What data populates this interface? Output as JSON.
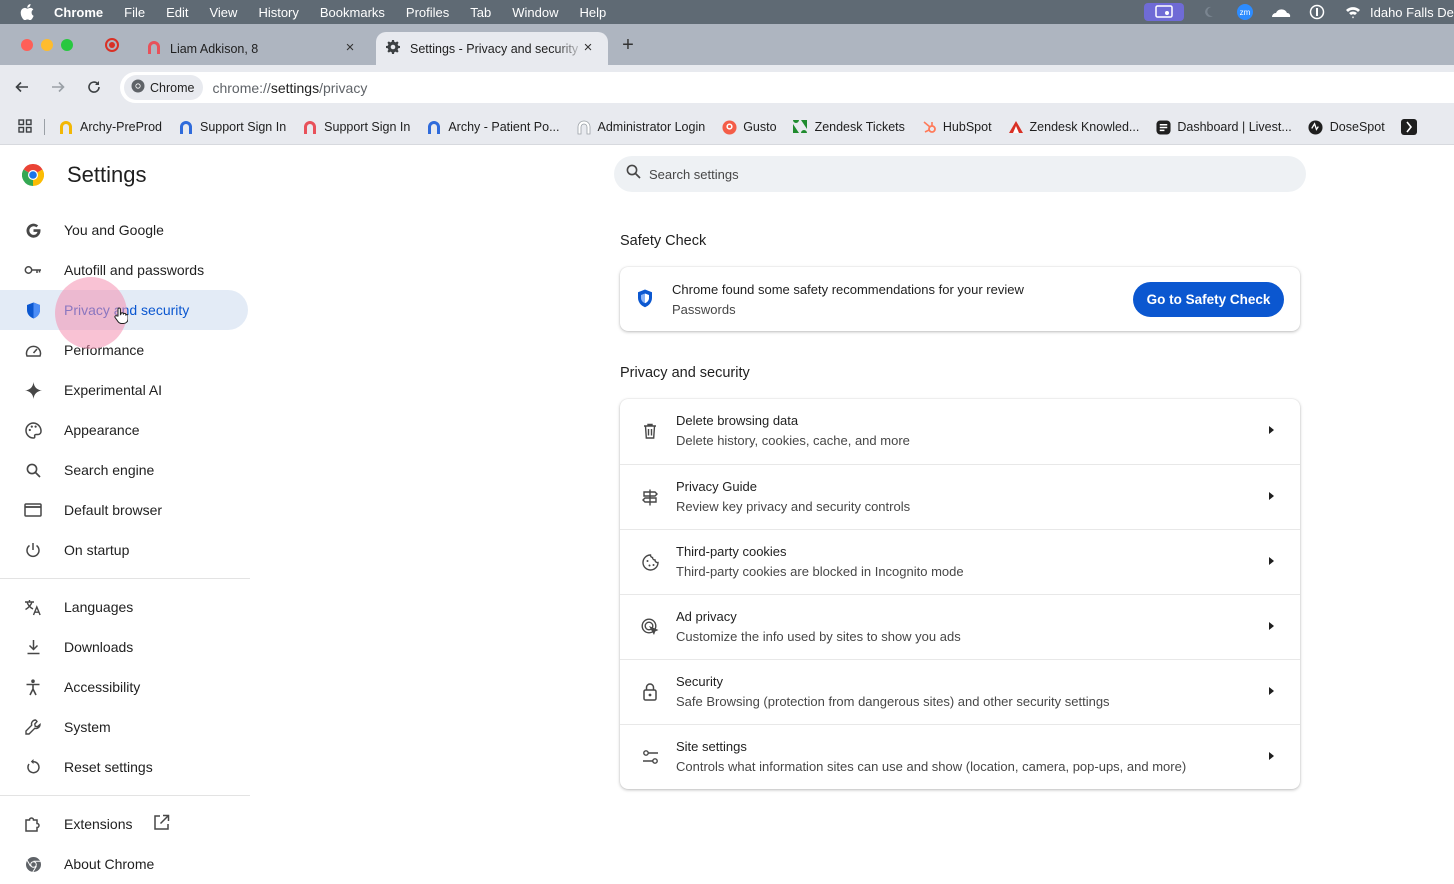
{
  "menubar": {
    "items": [
      "Chrome",
      "File",
      "Edit",
      "View",
      "History",
      "Bookmarks",
      "Profiles",
      "Tab",
      "Window",
      "Help"
    ],
    "right_text": "Idaho Falls De",
    "zoom_label": "zm"
  },
  "tabs": [
    {
      "title": "Liam Adkison, 8",
      "close": "×",
      "icon": "archy-logo-icon"
    },
    {
      "title": "Settings - Privacy and security",
      "close": "×",
      "icon": "gear-icon"
    }
  ],
  "new_tab_label": "+",
  "toolbar": {
    "chip_label": "Chrome",
    "url_prefix": "chrome://",
    "url_strong": "settings",
    "url_suffix": "/privacy"
  },
  "bookmarks": [
    {
      "label": "Archy-PreProd",
      "icon": "archy-logo-icon"
    },
    {
      "label": "Support Sign In",
      "icon": "archy-logo-icon"
    },
    {
      "label": "Support Sign In",
      "icon": "archy-logo-icon"
    },
    {
      "label": "Archy - Patient Po...",
      "icon": "archy-logo-icon"
    },
    {
      "label": "Administrator Login",
      "icon": "archy-logo-icon"
    },
    {
      "label": "Gusto",
      "icon": "gusto-icon"
    },
    {
      "label": "Zendesk Tickets",
      "icon": "zendesk-icon"
    },
    {
      "label": "HubSpot",
      "icon": "hubspot-icon"
    },
    {
      "label": "Zendesk Knowled...",
      "icon": "zendesk-guide-icon"
    },
    {
      "label": "Dashboard | Livest...",
      "icon": "dashboard-icon"
    },
    {
      "label": "DoseSpot",
      "icon": "dosespot-icon"
    }
  ],
  "settings": {
    "title": "Settings",
    "search_placeholder": "Search settings",
    "nav_group1": [
      {
        "label": "You and Google",
        "icon": "google-g-icon"
      },
      {
        "label": "Autofill and passwords",
        "icon": "key-icon"
      },
      {
        "label": "Privacy and security",
        "icon": "shield-icon",
        "active": true
      },
      {
        "label": "Performance",
        "icon": "speedometer-icon"
      },
      {
        "label": "Experimental AI",
        "icon": "sparkle-icon"
      },
      {
        "label": "Appearance",
        "icon": "palette-icon"
      },
      {
        "label": "Search engine",
        "icon": "search-icon"
      },
      {
        "label": "Default browser",
        "icon": "browser-window-icon"
      },
      {
        "label": "On startup",
        "icon": "power-icon"
      }
    ],
    "nav_group2": [
      {
        "label": "Languages",
        "icon": "translate-icon"
      },
      {
        "label": "Downloads",
        "icon": "download-icon"
      },
      {
        "label": "Accessibility",
        "icon": "accessibility-icon"
      },
      {
        "label": "System",
        "icon": "wrench-icon"
      },
      {
        "label": "Reset settings",
        "icon": "reset-icon"
      }
    ],
    "nav_group3": [
      {
        "label": "Extensions",
        "icon": "puzzle-icon"
      },
      {
        "label": "About Chrome",
        "icon": "chrome-logo-icon"
      }
    ],
    "safety_check": {
      "heading": "Safety Check",
      "title": "Chrome found some safety recommendations for your review",
      "subtitle": "Passwords",
      "button": "Go to Safety Check"
    },
    "privacy": {
      "heading": "Privacy and security",
      "rows": [
        {
          "title": "Delete browsing data",
          "subtitle": "Delete history, cookies, cache, and more",
          "icon": "trash-icon"
        },
        {
          "title": "Privacy Guide",
          "subtitle": "Review key privacy and security controls",
          "icon": "signpost-icon"
        },
        {
          "title": "Third-party cookies",
          "subtitle": "Third-party cookies are blocked in Incognito mode",
          "icon": "cookie-icon"
        },
        {
          "title": "Ad privacy",
          "subtitle": "Customize the info used by sites to show you ads",
          "icon": "ad-privacy-icon"
        },
        {
          "title": "Security",
          "subtitle": "Safe Browsing (protection from dangerous sites) and other security settings",
          "icon": "lock-icon"
        },
        {
          "title": "Site settings",
          "subtitle": "Controls what information sites can use and show (location, camera, pop-ups, and more)",
          "icon": "sliders-icon"
        }
      ]
    }
  },
  "colors": {
    "accent": "#0b57d0",
    "active_nav_bg": "#e3ebf6",
    "menubar_bg": "#5f6a74",
    "tabstrip_bg": "#aeb5c0",
    "toolbar_bg": "#e8eaef"
  }
}
